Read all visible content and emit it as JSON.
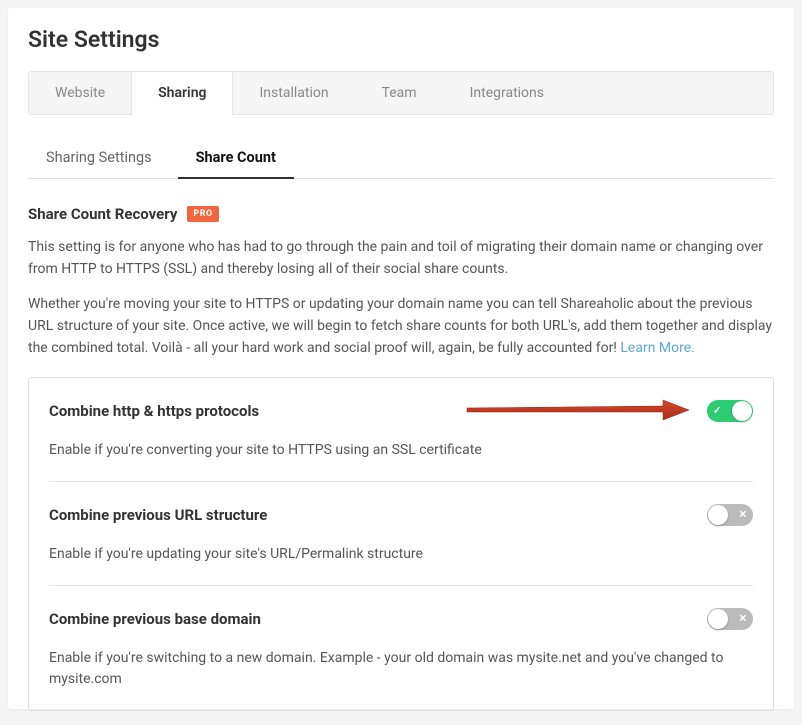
{
  "page": {
    "title": "Site Settings"
  },
  "main_tabs": [
    {
      "label": "Website",
      "active": false
    },
    {
      "label": "Sharing",
      "active": true
    },
    {
      "label": "Installation",
      "active": false
    },
    {
      "label": "Team",
      "active": false
    },
    {
      "label": "Integrations",
      "active": false
    }
  ],
  "sub_tabs": [
    {
      "label": "Sharing Settings",
      "active": false
    },
    {
      "label": "Share Count",
      "active": true
    }
  ],
  "section": {
    "title": "Share Count Recovery",
    "badge": "PRO",
    "paragraph1": "This setting is for anyone who has had to go through the pain and toil of migrating their domain name or changing over from HTTP to HTTPS (SSL) and thereby losing all of their social share counts.",
    "paragraph2_a": "Whether you're moving your site to HTTPS or updating your domain name you can tell Shareaholic about the previous URL structure of your site. Once active, we will begin to fetch share counts for both URL's, add them together and display the combined total. Voilà - all your hard work and social proof will, again, be fully accounted for! ",
    "learn_more": "Learn More."
  },
  "settings": [
    {
      "title": "Combine http & https protocols",
      "desc": "Enable if you're converting your site to HTTPS using an SSL certificate",
      "enabled": true
    },
    {
      "title": "Combine previous URL structure",
      "desc": "Enable if you're updating your site's URL/Permalink structure",
      "enabled": false
    },
    {
      "title": "Combine previous base domain",
      "desc": "Enable if you're switching to a new domain. Example - your old domain was mysite.net and you've changed to mysite.com",
      "enabled": false
    }
  ]
}
